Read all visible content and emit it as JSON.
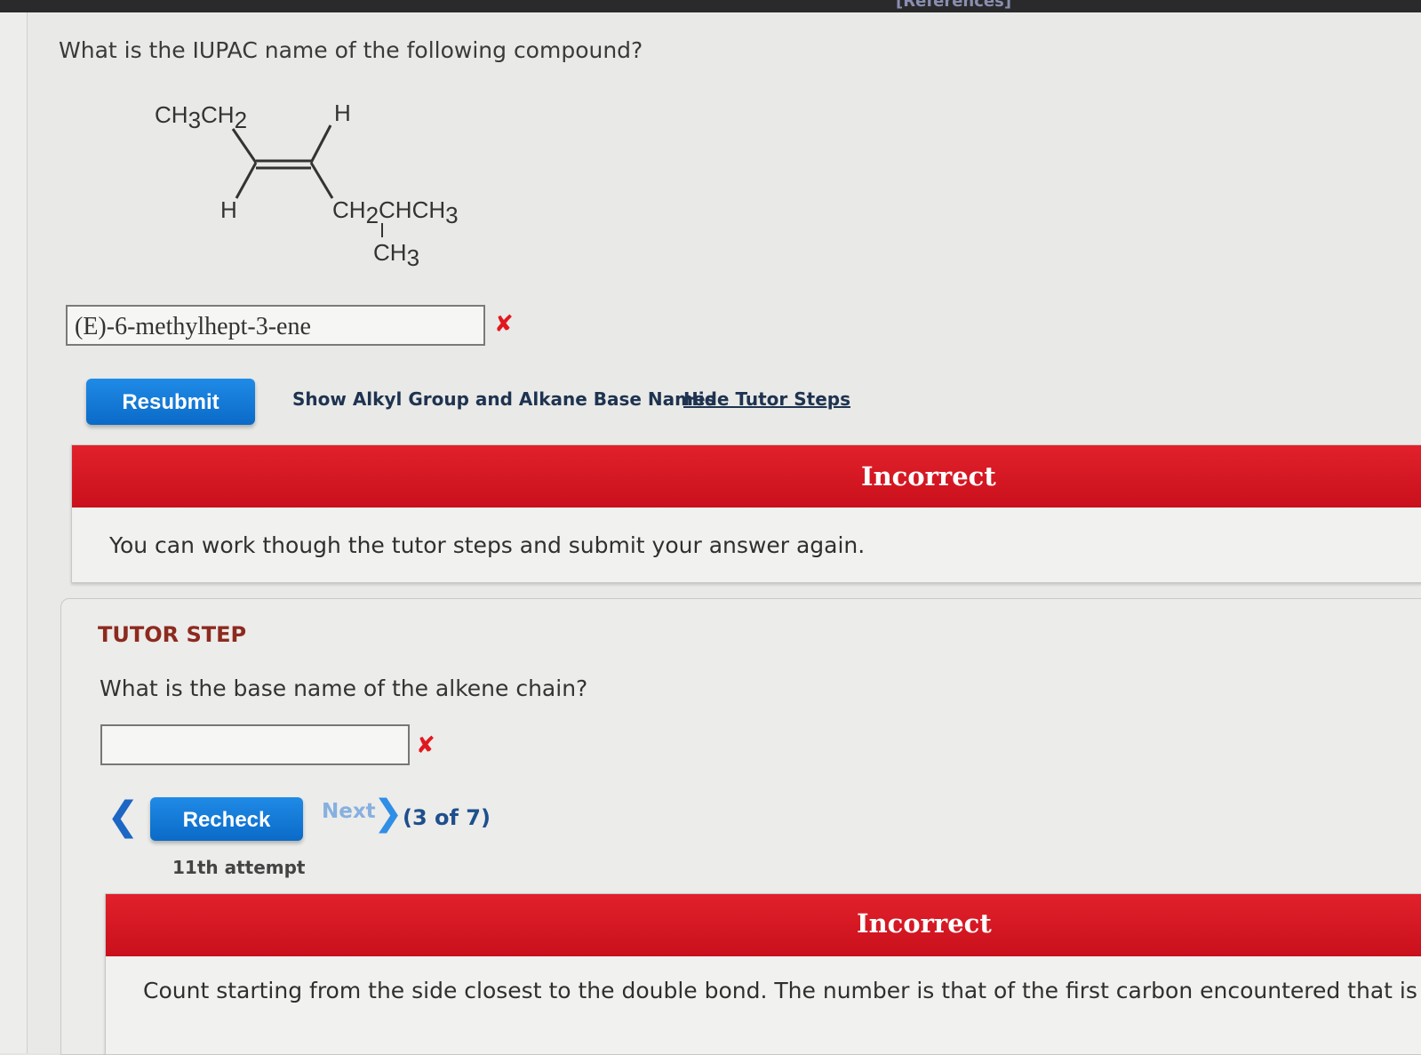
{
  "header": {
    "references_label": "[References]"
  },
  "question": {
    "text": "What is the IUPAC name of the following compound?",
    "answer_value": "(E)-6-methylhept-3-ene"
  },
  "molecule": {
    "top_left": {
      "main": "CH",
      "s1": "3",
      "mid": "CH",
      "s2": "2"
    },
    "top_right": "H",
    "bottom_left": "H",
    "bottom_right": {
      "a": "CH",
      "s1": "2",
      "b": "CHCH",
      "s2": "3"
    },
    "branch": {
      "a": "CH",
      "s1": "3"
    }
  },
  "actions": {
    "resubmit_label": "Resubmit",
    "show_names_link": "Show Alkyl Group and Alkane Base Names",
    "hide_steps_link": "Hide Tutor Steps"
  },
  "feedback_main": {
    "status": "Incorrect",
    "message": "You can work though the tutor steps and submit your answer again."
  },
  "tutor": {
    "label": "TUTOR STEP",
    "question": "What is the base name of the alkene chain?",
    "recheck_label": "Recheck",
    "next_label": "Next",
    "step_count": "(3 of 7)",
    "attempt": "11th attempt",
    "feedback_status": "Incorrect",
    "feedback_message": "Count starting from the side closest to the double bond. The number is that of the first carbon encountered that is part"
  },
  "icons": {
    "wrong_mark": "✘",
    "prev": "❮",
    "next": "❯"
  },
  "colors": {
    "incorrect_band": "#d8161f",
    "button_blue": "#1478d8",
    "tutor_label": "#8d2a1f"
  }
}
